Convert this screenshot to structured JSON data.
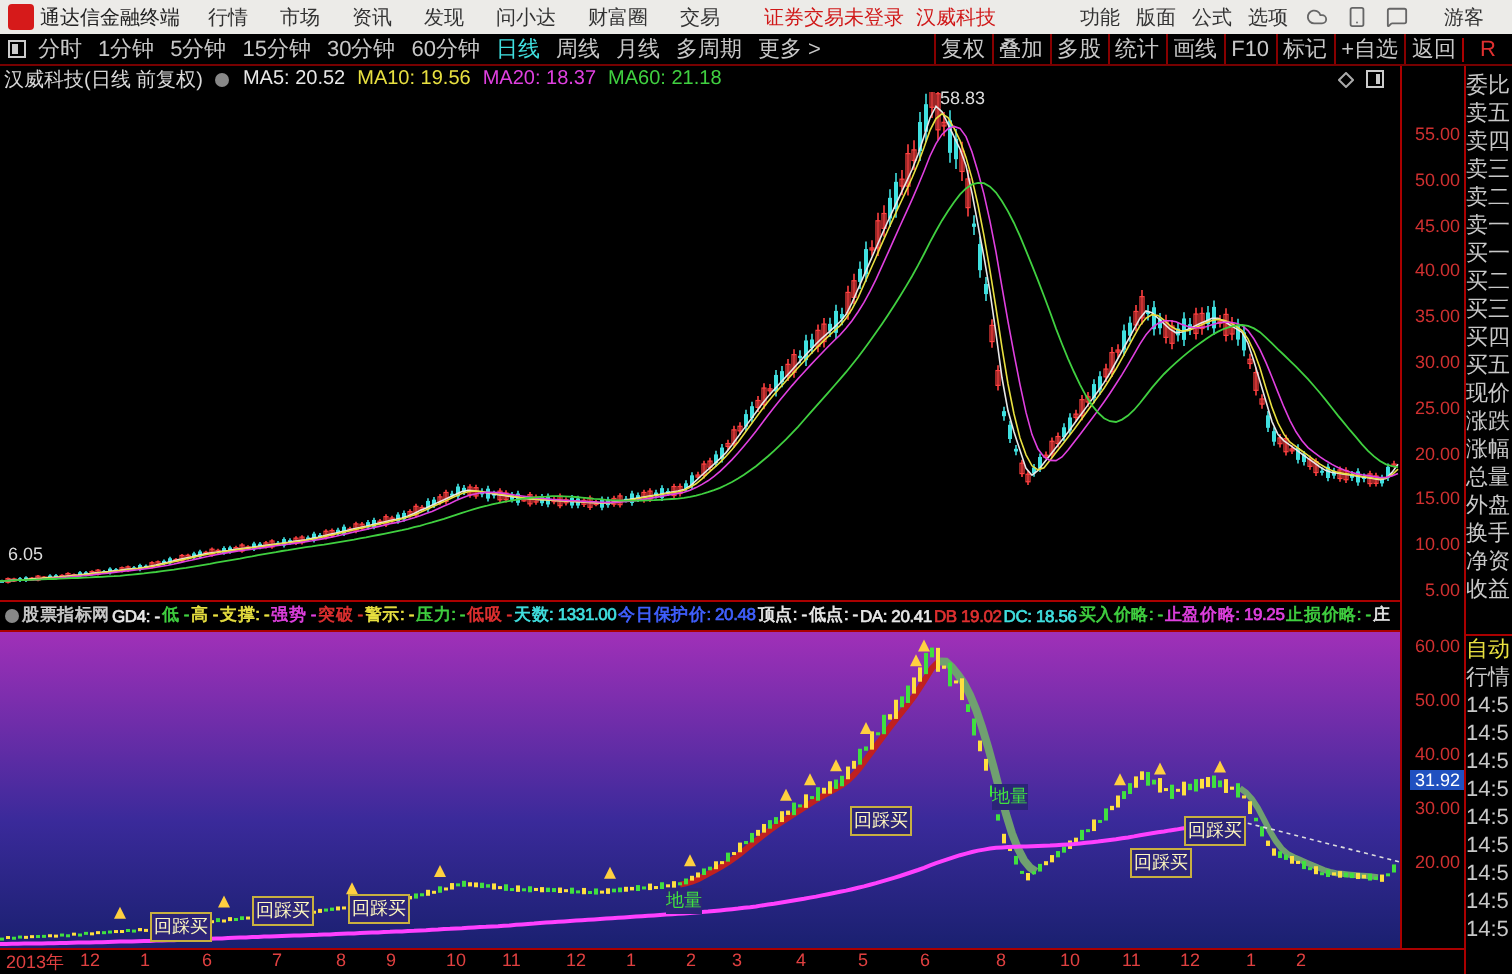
{
  "title_bar": {
    "app_name": "通达信金融终端",
    "menu": [
      "行情",
      "市场",
      "资讯",
      "发现",
      "问小达",
      "财富圈",
      "交易"
    ],
    "login_status": "证券交易未登录",
    "stock": "汉威科技",
    "tools": [
      "功能",
      "版面",
      "公式",
      "选项"
    ],
    "user": "游客"
  },
  "period_tabs": [
    {
      "label": "分时",
      "selected": false
    },
    {
      "label": "1分钟",
      "selected": false
    },
    {
      "label": "5分钟",
      "selected": false
    },
    {
      "label": "15分钟",
      "selected": false
    },
    {
      "label": "30分钟",
      "selected": false
    },
    {
      "label": "60分钟",
      "selected": false
    },
    {
      "label": "日线",
      "selected": true
    },
    {
      "label": "周线",
      "selected": false
    },
    {
      "label": "月线",
      "selected": false
    },
    {
      "label": "多周期",
      "selected": false
    },
    {
      "label": "更多 >",
      "selected": false
    }
  ],
  "toolbar_buttons": [
    "复权",
    "叠加",
    "多股",
    "统计",
    "画线",
    "F10",
    "标记",
    "+自选",
    "返回"
  ],
  "side_header": "R",
  "main_chart": {
    "title": "汉威科技(日线 前复权)",
    "ma": [
      {
        "label": "MA5: 20.52",
        "color": "#e8e8e8"
      },
      {
        "label": "MA10: 19.56",
        "color": "#e8e040"
      },
      {
        "label": "MA20: 18.37",
        "color": "#e040e0"
      },
      {
        "label": "MA60: 21.18",
        "color": "#40d040"
      }
    ],
    "high_label": "58.83",
    "low_label": "6.05",
    "y_axis": [
      "55.00",
      "50.00",
      "45.00",
      "40.00",
      "35.00",
      "30.00",
      "25.00",
      "20.00",
      "15.00",
      "10.00",
      "5.00"
    ]
  },
  "quote_labels": [
    "委比",
    "卖五",
    "卖四",
    "卖三",
    "卖二",
    "卖一",
    "买一",
    "买二",
    "买三",
    "买四",
    "买五",
    "现价",
    "涨跌",
    "涨幅",
    "总量",
    "外盘",
    "换手",
    "净资",
    "收益"
  ],
  "indicator": {
    "name": "股票指标网",
    "items": [
      {
        "text": "GD4: -",
        "color": "#e8e8e8"
      },
      {
        "text": "低 -",
        "color": "#40d040"
      },
      {
        "text": "高 -",
        "color": "#e8e040"
      },
      {
        "text": "支撑: -",
        "color": "#e8e040"
      },
      {
        "text": "强势 -",
        "color": "#e040e0"
      },
      {
        "text": "突破 -",
        "color": "#e03030"
      },
      {
        "text": "警示: -",
        "color": "#e8e040"
      },
      {
        "text": "压力: -",
        "color": "#40d040"
      },
      {
        "text": "低吸 -",
        "color": "#e03030"
      },
      {
        "text": "天数: 1331.00",
        "color": "#40e0e0"
      },
      {
        "text": "今日保护价: 20.48",
        "color": "#4060ff"
      },
      {
        "text": "顶点: -",
        "color": "#e8e8e8"
      },
      {
        "text": "低点: -",
        "color": "#e8e8e8"
      },
      {
        "text": "DA: 20.41",
        "color": "#e8e8e8"
      },
      {
        "text": "DB 19.02",
        "color": "#e03030"
      },
      {
        "text": "DC: 18.56",
        "color": "#40e0e0"
      },
      {
        "text": "买入价略: -",
        "color": "#40d040"
      },
      {
        "text": "止盈价略: 19.25",
        "color": "#e040e0"
      },
      {
        "text": "止损价略: -",
        "color": "#40d040"
      },
      {
        "text": "庄",
        "color": "#e8e8e8"
      }
    ]
  },
  "lower_chart": {
    "y_axis": [
      "60.00",
      "50.00",
      "40.00",
      "30.00",
      "20.00"
    ],
    "current_value": "31.92",
    "annotations": [
      {
        "kind": "buy",
        "text": "回踩买"
      },
      {
        "kind": "buy",
        "text": "回踩买"
      },
      {
        "kind": "buy",
        "text": "回踩买"
      },
      {
        "kind": "buy",
        "text": "回踩买"
      },
      {
        "kind": "buy",
        "text": "回踩买"
      },
      {
        "kind": "buy",
        "text": "回踩买"
      },
      {
        "kind": "volume",
        "text": "地量"
      },
      {
        "kind": "volume",
        "text": "地量"
      }
    ]
  },
  "lower_side": {
    "labels": [
      "自动",
      "行情"
    ],
    "times": [
      "14:5",
      "14:5",
      "14:5",
      "14:5",
      "14:5",
      "14:5",
      "14:5",
      "14:5",
      "14:5"
    ]
  },
  "x_axis": [
    "2013年",
    "12",
    "1",
    "6",
    "7",
    "8",
    "9",
    "10",
    "11",
    "12",
    "1",
    "2",
    "3",
    "4",
    "5",
    "6",
    "8",
    "10",
    "11",
    "12",
    "1",
    "2"
  ]
}
